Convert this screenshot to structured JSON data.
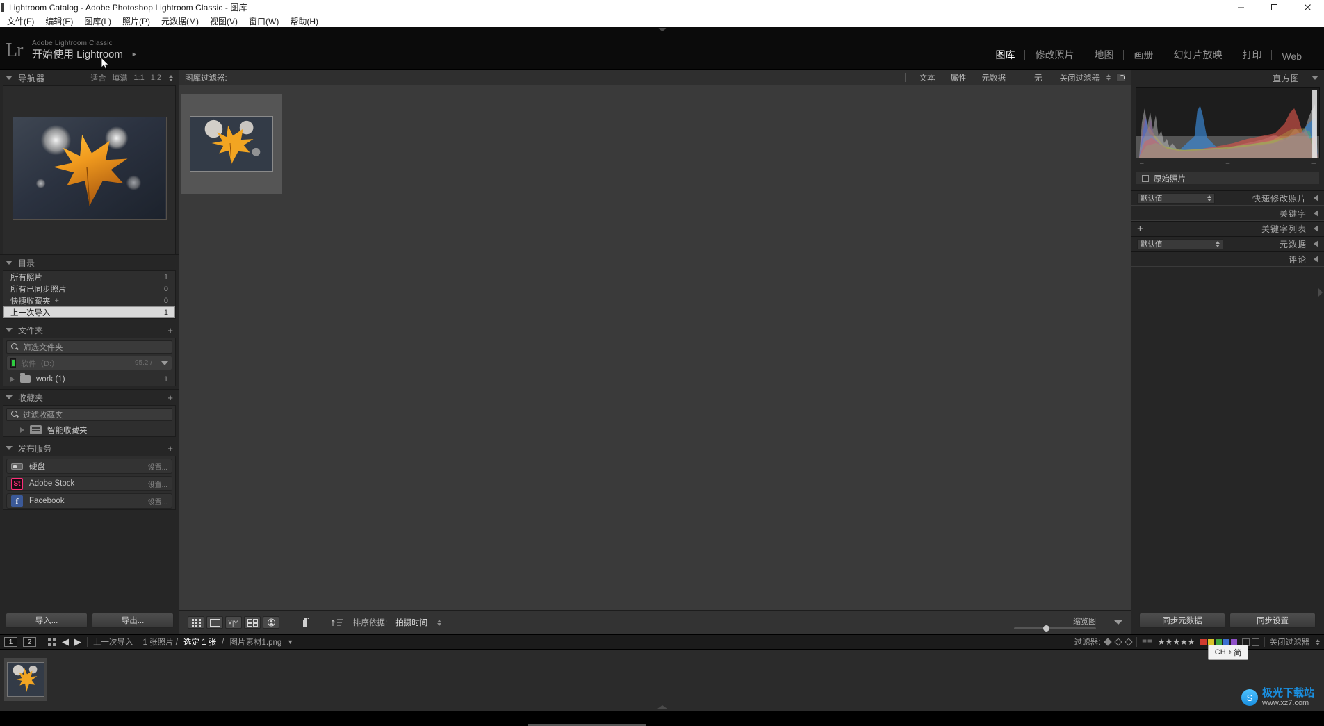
{
  "window": {
    "title": "Lightroom Catalog - Adobe Photoshop Lightroom Classic - 图库",
    "minimize": "—",
    "maximize": "□",
    "close": "✕"
  },
  "menubar": {
    "items": [
      {
        "label": "文件(F)"
      },
      {
        "label": "编辑(E)"
      },
      {
        "label": "图库(L)"
      },
      {
        "label": "照片(P)"
      },
      {
        "label": "元数据(M)"
      },
      {
        "label": "视图(V)"
      },
      {
        "label": "窗口(W)"
      },
      {
        "label": "帮助(H)"
      }
    ]
  },
  "identity": {
    "logo": "Lr",
    "sub": "Adobe Lightroom Classic",
    "main": "开始使用 Lightroom",
    "arrow": "►"
  },
  "modules": [
    {
      "label": "图库",
      "active": true
    },
    {
      "label": "修改照片",
      "active": false
    },
    {
      "label": "地图",
      "active": false
    },
    {
      "label": "画册",
      "active": false
    },
    {
      "label": "幻灯片放映",
      "active": false
    },
    {
      "label": "打印",
      "active": false
    },
    {
      "label": "Web",
      "active": false
    }
  ],
  "navigator": {
    "title": "导航器",
    "fit": "适合",
    "fill": "填满",
    "one_to_one": "1:1",
    "ratio": "1:2"
  },
  "catalog": {
    "title": "目录",
    "items": [
      {
        "label": "所有照片",
        "count": "1",
        "selected": false
      },
      {
        "label": "所有已同步照片",
        "count": "0",
        "selected": false
      },
      {
        "label": "快捷收藏夹",
        "count": "0",
        "selected": false,
        "plus": "+"
      },
      {
        "label": "上一次导入",
        "count": "1",
        "selected": true
      }
    ]
  },
  "folders": {
    "title": "文件夹",
    "plus": "+",
    "filter_placeholder": "筛选文件夹",
    "volume": {
      "name": "软件（D:）",
      "free": "95.2 /"
    },
    "items": [
      {
        "label": "work (1)",
        "count": "1"
      }
    ]
  },
  "collections": {
    "title": "收藏夹",
    "plus": "+",
    "filter_placeholder": "过滤收藏夹",
    "items": [
      {
        "label": "智能收藏夹"
      }
    ]
  },
  "publish": {
    "title": "发布服务",
    "plus": "+",
    "items": [
      {
        "label": "硬盘",
        "settings": "设置...",
        "icon": "harddrive-icon"
      },
      {
        "label": "Adobe Stock",
        "settings": "设置...",
        "icon": "adobe-stock-icon"
      },
      {
        "label": "Facebook",
        "settings": "设置...",
        "icon": "facebook-icon"
      }
    ]
  },
  "left_footer": {
    "import": "导入...",
    "export": "导出..."
  },
  "library_filter": {
    "label": "图库过滤器:",
    "tabs": [
      {
        "label": "文本"
      },
      {
        "label": "属性"
      },
      {
        "label": "元数据"
      },
      {
        "label": "无"
      }
    ],
    "close_filter": "关闭过滤器",
    "lock_icon": "lock-icon"
  },
  "toolbar": {
    "grid_view_icon": "grid-view-icon",
    "loupe_view_icon": "loupe-view-icon",
    "compare_view_icon": "compare-view-icon",
    "survey_view_icon": "survey-view-icon",
    "people_view_icon": "people-view-icon",
    "spray_icon": "spray-can-icon",
    "sort_icon": "sort-icon",
    "sort_label": "排序依据:",
    "sort_value": "拍摄时间",
    "thumbnail_label": "缩览图",
    "slider_value": 36
  },
  "histogram": {
    "title": "直方图",
    "original_photo": "原始照片"
  },
  "right_sections": [
    {
      "title": "快速修改照片",
      "preset": "默认值",
      "has_preset": true
    },
    {
      "title": "关键字",
      "preset": "",
      "has_preset": false
    },
    {
      "title": "关键字列表",
      "preset": "",
      "has_preset": false,
      "plus": "+"
    },
    {
      "title": "元数据",
      "preset": "默认值",
      "has_preset": true
    },
    {
      "title": "评论",
      "preset": "",
      "has_preset": false
    }
  ],
  "right_footer": {
    "sync_metadata": "同步元数据",
    "sync_settings": "同步设置"
  },
  "statusbar": {
    "screen1": "1",
    "screen2": "2",
    "grid_icon": "grid-icon",
    "back_icon": "arrow-left-icon",
    "forward_icon": "arrow-right-icon",
    "source": "上一次导入",
    "photo_count": "1 张照片 /",
    "selected": "选定 1 张",
    "slash": "/",
    "filename": "图片素材1.png",
    "dropdown_icon": "chevron-down-icon",
    "filter_label": "过滤器:",
    "stars": "★★★★★"
  },
  "ime": {
    "lang": "CH",
    "note": "♪",
    "mode": "简"
  },
  "watermark": {
    "badge": "S",
    "title": "极光下载站",
    "sub": "www.xz7.com"
  }
}
